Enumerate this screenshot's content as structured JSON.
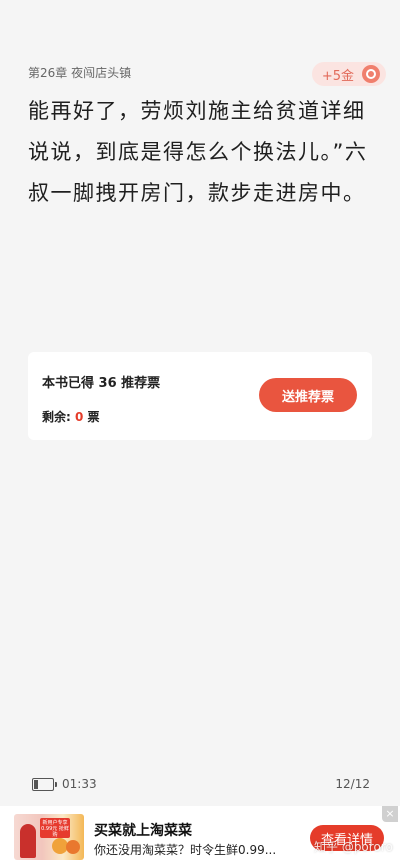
{
  "header": {
    "chapter_title": "第26章 夜闯店头镇",
    "coin_reward": "+5金",
    "coin_icon": "gold-coin-icon"
  },
  "content": {
    "text": "能再好了，劳烦刘施主给贫道详细说说，到底是得怎么个换法儿。”六叔一脚拽开房门，款步走进房中。"
  },
  "vote_card": {
    "count_text": "本书已得 36 推荐票",
    "remaining_label": "剩余:",
    "remaining_value": "0",
    "remaining_unit": "票",
    "send_button": "送推荐票"
  },
  "status_bar": {
    "battery_level": 0.2,
    "time": "01:33",
    "page": "12/12"
  },
  "ad": {
    "title": "买菜就上淘菜菜",
    "description": "你还没用淘菜菜？时令生鲜0.99...",
    "button": "查看详情",
    "close": "×",
    "image_promo": "新用户专享 0.99元 抢鲜购"
  },
  "watermark": "知乎 @pororo",
  "colors": {
    "accent": "#e9553f",
    "background": "#f5f5f5"
  }
}
